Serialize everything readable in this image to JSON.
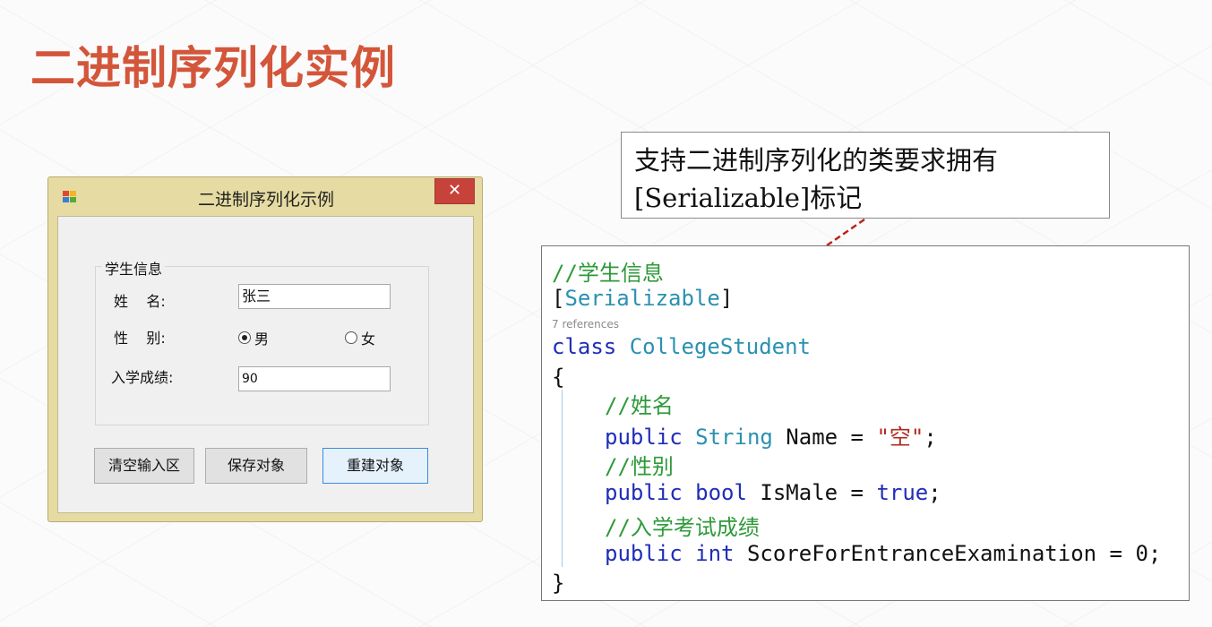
{
  "slide": {
    "title": "二进制序列化实例"
  },
  "window": {
    "title": "二进制序列化示例",
    "close_glyph": "✕",
    "groupbox_label": "学生信息",
    "name_label": "姓    名:",
    "name_value": "张三",
    "gender_label": "性    别:",
    "gender_options": [
      {
        "label": "男",
        "selected": true
      },
      {
        "label": "女",
        "selected": false
      }
    ],
    "score_label": "入学成绩:",
    "score_value": "90",
    "buttons": {
      "clear": "清空输入区",
      "save": "保存对象",
      "rebuild": "重建对象"
    }
  },
  "callout": {
    "line1": "支持二进制序列化的类要求拥有",
    "line2": "[Serializable]标记"
  },
  "code": {
    "comment_class": "//学生信息",
    "attr_open": "[",
    "attr_name": "Serializable",
    "attr_close": "]",
    "references": "7 references",
    "kw_class": "class",
    "class_name": "CollegeStudent",
    "brace_open": "{",
    "comment_name": "//姓名",
    "kw_public": "public",
    "type_string": "String",
    "name_decl": " Name = ",
    "name_str": "\"空\"",
    "semicolon": ";",
    "comment_gender": "//性别",
    "kw_bool": "bool",
    "ismale_decl": " IsMale = ",
    "kw_true": "true",
    "comment_score": "//入学考试成绩",
    "kw_int": "int",
    "score_decl": " ScoreForEntranceExamination = 0;",
    "brace_close": "}"
  },
  "colors": {
    "title": "#d3563a",
    "comment": "#2e9a3a",
    "keyword": "#1f2db8",
    "type": "#2a91af",
    "string": "#b02a1f",
    "close_button": "#c7423a",
    "arrow": "#c0201a"
  }
}
